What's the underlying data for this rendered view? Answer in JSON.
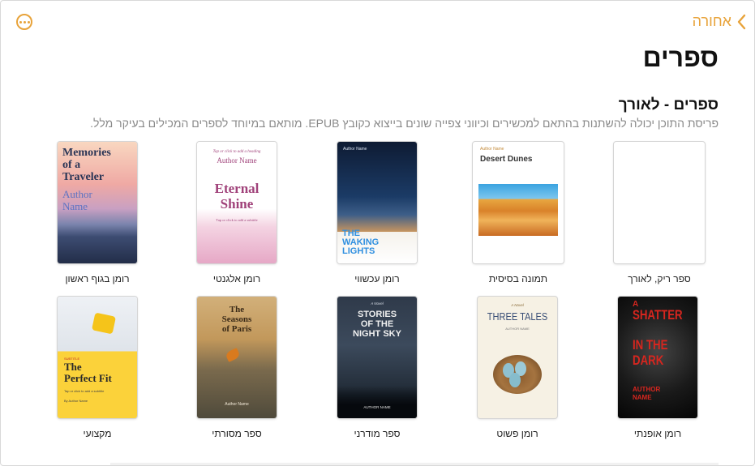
{
  "nav": {
    "back_label": "אחורה"
  },
  "header": {
    "title": "ספרים"
  },
  "section": {
    "title": "ספרים - לאורך",
    "description": "פריסת התוכן יכולה להשתנות בהתאם למכשירים וכיווני צפייה שונים בייצוא כקובץ EPUB. מותאם במיוחד לספרים המכילים בעיקר מלל."
  },
  "templates": [
    {
      "label": "ספר ריק, לאורך",
      "cover_text": []
    },
    {
      "label": "תמונה בסיסית",
      "cover_text": [
        "Author Name",
        "Desert Dunes"
      ]
    },
    {
      "label": "רומן עכשווי",
      "cover_text": [
        "Author Name",
        "THE",
        "WAKING",
        "LIGHTS"
      ]
    },
    {
      "label": "רומן אלגנטי",
      "cover_text": [
        "Tap or click to add a heading",
        "Author Name",
        "Eternal",
        "Shine",
        "Tap or click to add a subtitle"
      ]
    },
    {
      "label": "רומן בגוף ראשון",
      "cover_text": [
        "Memories",
        "of a",
        "Traveler",
        "Author",
        "Name"
      ]
    },
    {
      "label": "רומן אופנתי",
      "cover_text": [
        "A",
        "SHATTER",
        "IN THE",
        "DARK",
        "AUTHOR",
        "NAME"
      ]
    },
    {
      "label": "רומן פשוט",
      "cover_text": [
        "A Novel",
        "THREE TALES",
        "AUTHOR NAME"
      ]
    },
    {
      "label": "ספר מודרני",
      "cover_text": [
        "A Novel",
        "STORIES",
        "OF THE",
        "NIGHT SKY",
        "AUTHOR NAME"
      ]
    },
    {
      "label": "ספר מסורתי",
      "cover_text": [
        "The",
        "Seasons",
        "of Paris",
        "Author Name"
      ]
    },
    {
      "label": "מקצועי",
      "cover_text": [
        "SUBTITLE",
        "The",
        "Perfect Fit",
        "Tap or click to add a subtitle",
        "By Author Name"
      ]
    }
  ],
  "colors": {
    "accent": "#e8a33a",
    "text": "#111111",
    "muted": "#8a8a8a"
  },
  "icons": {
    "more": "ellipsis-circle-icon",
    "back": "chevron-left-icon"
  }
}
